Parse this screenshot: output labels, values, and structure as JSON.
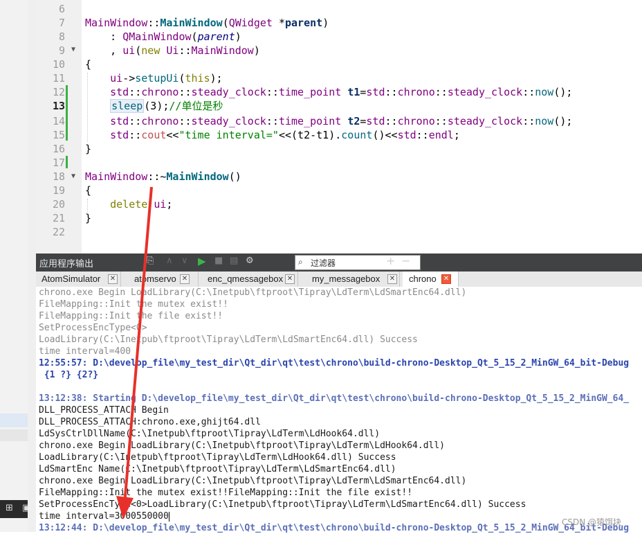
{
  "editor": {
    "lines": [
      {
        "num": "6",
        "text": ""
      },
      {
        "num": "7",
        "text": "MainWindow::MainWindow(QWidget *parent)"
      },
      {
        "num": "8",
        "text": "    : QMainWindow(parent)"
      },
      {
        "num": "9",
        "text": "    , ui(new Ui::MainWindow)"
      },
      {
        "num": "10",
        "text": "{"
      },
      {
        "num": "11",
        "text": "    ui->setupUi(this);"
      },
      {
        "num": "12",
        "text": "    std::chrono::steady_clock::time_point t1=std::chrono::steady_clock::now();"
      },
      {
        "num": "13",
        "text": "    sleep(3);//单位是秒"
      },
      {
        "num": "14",
        "text": "    std::chrono::steady_clock::time_point t2=std::chrono::steady_clock::now();"
      },
      {
        "num": "15",
        "text": "    std::cout<<\"time interval=\"<<(t2-t1).count()<<std::endl;"
      },
      {
        "num": "16",
        "text": "}"
      },
      {
        "num": "17",
        "text": ""
      },
      {
        "num": "18",
        "text": "MainWindow::~MainWindow()"
      },
      {
        "num": "19",
        "text": "{"
      },
      {
        "num": "20",
        "text": "    delete ui;"
      },
      {
        "num": "21",
        "text": "}"
      },
      {
        "num": "22",
        "text": ""
      }
    ],
    "current_line": "13"
  },
  "output_panel": {
    "title": "应用程序输出",
    "filter_placeholder": "过滤器",
    "tabs": [
      {
        "label": "AtomSimulator",
        "active": false
      },
      {
        "label": "atomservo",
        "active": false
      },
      {
        "label": "enc_qmessagebox",
        "active": false
      },
      {
        "label": "my_messagebox",
        "active": false
      },
      {
        "label": "chrono",
        "active": true
      }
    ],
    "lines": [
      {
        "text": "chrono.exe Begin LoadLibrary(C:\\Inetpub\\ftproot\\Tipray\\LdTerm\\LdSmartEnc64.dll)",
        "style": "g"
      },
      {
        "text": "FileMapping::Init the mutex exist!!",
        "style": "g"
      },
      {
        "text": "FileMapping::Init the file exist!!",
        "style": "g"
      },
      {
        "text": "SetProcessEncType<0>",
        "style": "g"
      },
      {
        "text": "LoadLibrary(C:\\Inetpub\\ftproot\\Tipray\\LdTerm\\LdSmartEnc64.dll) Success",
        "style": "g"
      },
      {
        "text": "time interval=400",
        "style": "g"
      },
      {
        "text": "12:55:57: D:\\develop_file\\my_test_dir\\Qt_dir\\qt\\test\\chrono\\build-chrono-Desktop_Qt_5_15_2_MinGW_64_bit-Debug",
        "style": "bl"
      },
      {
        "text": " {1 ?} {2?}",
        "style": "bl2"
      },
      {
        "text": "",
        "style": "n"
      },
      {
        "text": "13:12:38: Starting D:\\develop_file\\my_test_dir\\Qt_dir\\qt\\test\\chrono\\build-chrono-Desktop_Qt_5_15_2_MinGW_64_",
        "style": "dim"
      },
      {
        "text": "DLL_PROCESS_ATTACH Begin",
        "style": "n"
      },
      {
        "text": "DLL_PROCESS_ATTACH:chrono.exe,ghijt64.dll",
        "style": "n"
      },
      {
        "text": "LdSysCtrlDllName(C:\\Inetpub\\ftproot\\Tipray\\LdTerm\\LdHook64.dll)",
        "style": "n"
      },
      {
        "text": "chrono.exe Begin LoadLibrary(C:\\Inetpub\\ftproot\\Tipray\\LdTerm\\LdHook64.dll)",
        "style": "n"
      },
      {
        "text": "LoadLibrary(C:\\Inetpub\\ftproot\\Tipray\\LdTerm\\LdHook64.dll) Success",
        "style": "n"
      },
      {
        "text": "LdSmartEnc Name(C:\\Inetpub\\ftproot\\Tipray\\LdTerm\\LdSmartEnc64.dll)",
        "style": "n"
      },
      {
        "text": "chrono.exe Begin LoadLibrary(C:\\Inetpub\\ftproot\\Tipray\\LdTerm\\LdSmartEnc64.dll)",
        "style": "n"
      },
      {
        "text": "FileMapping::Init the mutex exist!!FileMapping::Init the file exist!!",
        "style": "n"
      },
      {
        "text": "SetProcessEncType<0>LoadLibrary(C:\\Inetpub\\ftproot\\Tipray\\LdTerm\\LdSmartEnc64.dll) Success",
        "style": "n"
      },
      {
        "text": "time interval=3000550000",
        "style": "n"
      },
      {
        "text": "13:12:44: D:\\develop_file\\my_test_dir\\Qt_dir\\qt\\test\\chrono\\build-chrono-Desktop_Qt_5_15_2_MinGW_64_bit-Debug",
        "style": "dim"
      }
    ]
  },
  "watermark": "CSDN @猿饵块",
  "colors": {
    "annotation_arrow": "#e8302a",
    "panel_bar": "#404244",
    "diff_marker": "#3cb043"
  }
}
